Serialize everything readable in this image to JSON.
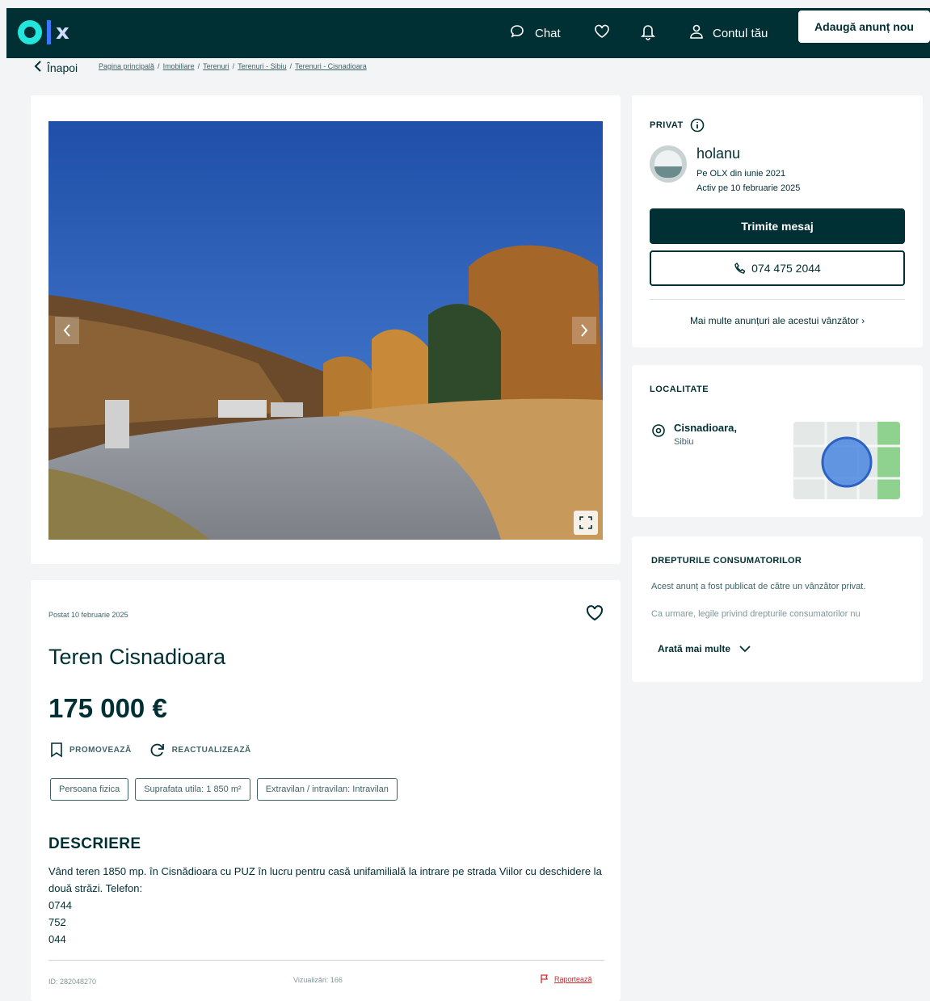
{
  "header": {
    "logo": "olx",
    "chat_label": "Chat",
    "account_label": "Contul tău",
    "add_listing_label": "Adaugă anunț nou",
    "icons": [
      "chat-icon",
      "heart-icon",
      "bell-icon",
      "user-icon"
    ]
  },
  "breadcrumb": {
    "back_label": "Înapoi",
    "items": [
      "Pagina principală",
      "Imobiliare",
      "Terenuri",
      "Terenuri - Sibiu",
      "Terenuri - Cisnadioara"
    ]
  },
  "listing": {
    "posted": "Postat 10 februarie 2025",
    "title": "Teren Cisnadioara",
    "price": "175 000 €",
    "promote_label": "PROMOVEAZĂ",
    "refresh_label": "REACTUALIZEAZĂ",
    "tags": [
      "Persoana fizica",
      "Suprafata utila: 1 850 m²",
      "Extravilan / intravilan: Intravilan"
    ],
    "description_heading": "DESCRIERE",
    "description": "Vând teren 1850 mp. în Cisnădioara cu PUZ în lucru pentru casă unifamilială la intrare pe strada Viilor cu deschidere la două străzi. Telefon:\n0744\n752\n044",
    "id_label": "ID: 282048270",
    "views_label": "Vizualizări: 166",
    "report_label": "Raportează"
  },
  "seller": {
    "type_label": "PRIVAT",
    "name": "holanu",
    "member_since": "Pe OLX din iunie 2021",
    "last_active": "Activ pe 10 februarie 2025",
    "message_button": "Trimite mesaj",
    "phone": "074 475 2044",
    "more_ads": "Mai multe anunțuri ale acestui vânzător"
  },
  "location": {
    "heading": "LOCALITATE",
    "city": "Cisnadioara,",
    "region": "Sibiu"
  },
  "consumer_rights": {
    "heading": "DREPTURILE CONSUMATORILOR",
    "p1": "Acest anunț a fost publicat de către un vânzător privat.",
    "p2": "Ca urmare, legile privind drepturile consumatorilor nu",
    "more_label": "Arată mai multe"
  },
  "colors": {
    "primary": "#002f34",
    "accent_teal": "#23e5db",
    "accent_blue": "#3a77ff",
    "report_red": "#d42a31",
    "background": "#f2f4f5"
  }
}
